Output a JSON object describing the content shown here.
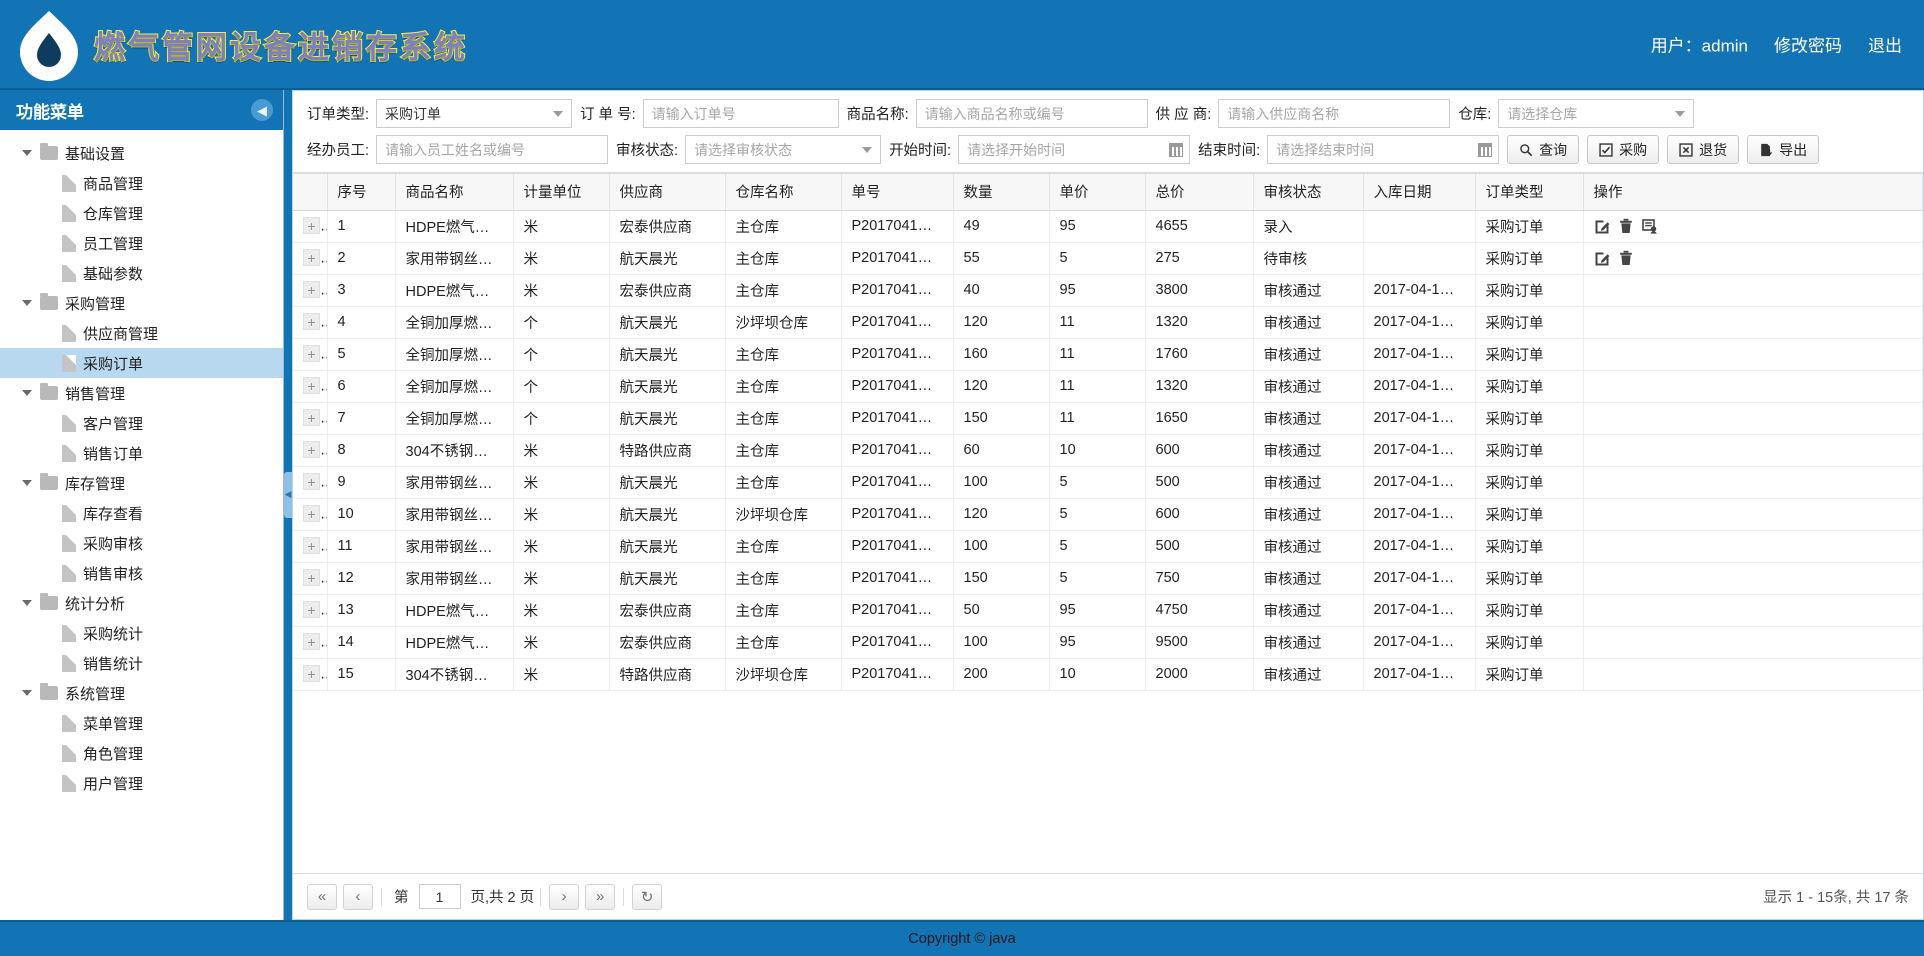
{
  "header": {
    "title": "燃气管网设备进销存系统",
    "logo_icon": "gas-drop-flame-logo",
    "user_label": "用户：admin",
    "change_password": "修改密码",
    "logout": "退出"
  },
  "sidebar": {
    "title": "功能菜单",
    "collapse_icon": "chevron-left-icon",
    "groups": [
      {
        "label": "基础设置",
        "children": [
          "商品管理",
          "仓库管理",
          "员工管理",
          "基础参数"
        ]
      },
      {
        "label": "采购管理",
        "children": [
          "供应商管理",
          "采购订单"
        ]
      },
      {
        "label": "销售管理",
        "children": [
          "客户管理",
          "销售订单"
        ]
      },
      {
        "label": "库存管理",
        "children": [
          "库存查看",
          "采购审核",
          "销售审核"
        ]
      },
      {
        "label": "统计分析",
        "children": [
          "采购统计",
          "销售统计"
        ]
      },
      {
        "label": "系统管理",
        "children": [
          "菜单管理",
          "角色管理",
          "用户管理"
        ]
      }
    ],
    "active_item": "采购订单"
  },
  "filters": {
    "order_type": {
      "label": "订单类型:",
      "value": "采购订单"
    },
    "order_no": {
      "label": "订 单 号:",
      "placeholder": "请输入订单号",
      "value": ""
    },
    "goods_name": {
      "label": "商品名称:",
      "placeholder": "请输入商品名称或编号",
      "value": ""
    },
    "supplier": {
      "label": "供 应 商:",
      "placeholder": "请输入供应商名称",
      "value": ""
    },
    "warehouse": {
      "label": "仓库:",
      "placeholder": "请选择仓库",
      "value": ""
    },
    "staff": {
      "label": "经办员工:",
      "placeholder": "请输入员工姓名或编号",
      "value": ""
    },
    "audit_status": {
      "label": "审核状态:",
      "placeholder": "请选择审核状态",
      "value": ""
    },
    "start_time": {
      "label": "开始时间:",
      "placeholder": "请选择开始时间",
      "value": ""
    },
    "end_time": {
      "label": "结束时间:",
      "placeholder": "请选择结束时间",
      "value": ""
    },
    "buttons": [
      {
        "label": "查询",
        "icon": "search-icon"
      },
      {
        "label": "采购",
        "icon": "checkbox-check-icon"
      },
      {
        "label": "退货",
        "icon": "box-x-icon"
      },
      {
        "label": "导出",
        "icon": "export-file-icon"
      }
    ]
  },
  "table": {
    "columns": [
      "序号",
      "商品名称",
      "计量单位",
      "供应商",
      "仓库名称",
      "单号",
      "数量",
      "单价",
      "总价",
      "审核状态",
      "入库日期",
      "订单类型",
      "操作"
    ],
    "expand_icon": "plus-expand-icon",
    "rows": [
      {
        "no": "1",
        "goods": "HDPE燃气…",
        "unit": "米",
        "supplier": "宏泰供应商",
        "warehouse": "主仓库",
        "order_no": "P2017041…",
        "qty": "49",
        "price": "95",
        "total": "4655",
        "status": "录入",
        "in_date": "",
        "type": "采购订单",
        "ops": [
          "edit-icon",
          "delete-icon",
          "submit-audit-icon"
        ]
      },
      {
        "no": "2",
        "goods": "家用带钢丝…",
        "unit": "米",
        "supplier": "航天晨光",
        "warehouse": "主仓库",
        "order_no": "P2017041…",
        "qty": "55",
        "price": "5",
        "total": "275",
        "status": "待审核",
        "in_date": "",
        "type": "采购订单",
        "ops": [
          "edit-icon",
          "delete-icon"
        ]
      },
      {
        "no": "3",
        "goods": "HDPE燃气…",
        "unit": "米",
        "supplier": "宏泰供应商",
        "warehouse": "主仓库",
        "order_no": "P2017041…",
        "qty": "40",
        "price": "95",
        "total": "3800",
        "status": "审核通过",
        "in_date": "2017-04-1…",
        "type": "采购订单",
        "ops": []
      },
      {
        "no": "4",
        "goods": "全铜加厚燃…",
        "unit": "个",
        "supplier": "航天晨光",
        "warehouse": "沙坪坝仓库",
        "order_no": "P2017041…",
        "qty": "120",
        "price": "11",
        "total": "1320",
        "status": "审核通过",
        "in_date": "2017-04-1…",
        "type": "采购订单",
        "ops": []
      },
      {
        "no": "5",
        "goods": "全铜加厚燃…",
        "unit": "个",
        "supplier": "航天晨光",
        "warehouse": "主仓库",
        "order_no": "P2017041…",
        "qty": "160",
        "price": "11",
        "total": "1760",
        "status": "审核通过",
        "in_date": "2017-04-1…",
        "type": "采购订单",
        "ops": []
      },
      {
        "no": "6",
        "goods": "全铜加厚燃…",
        "unit": "个",
        "supplier": "航天晨光",
        "warehouse": "主仓库",
        "order_no": "P2017041…",
        "qty": "120",
        "price": "11",
        "total": "1320",
        "status": "审核通过",
        "in_date": "2017-04-1…",
        "type": "采购订单",
        "ops": []
      },
      {
        "no": "7",
        "goods": "全铜加厚燃…",
        "unit": "个",
        "supplier": "航天晨光",
        "warehouse": "主仓库",
        "order_no": "P2017041…",
        "qty": "150",
        "price": "11",
        "total": "1650",
        "status": "审核通过",
        "in_date": "2017-04-1…",
        "type": "采购订单",
        "ops": []
      },
      {
        "no": "8",
        "goods": "304不锈钢…",
        "unit": "米",
        "supplier": "特路供应商",
        "warehouse": "主仓库",
        "order_no": "P2017041…",
        "qty": "60",
        "price": "10",
        "total": "600",
        "status": "审核通过",
        "in_date": "2017-04-1…",
        "type": "采购订单",
        "ops": []
      },
      {
        "no": "9",
        "goods": "家用带钢丝…",
        "unit": "米",
        "supplier": "航天晨光",
        "warehouse": "主仓库",
        "order_no": "P2017041…",
        "qty": "100",
        "price": "5",
        "total": "500",
        "status": "审核通过",
        "in_date": "2017-04-1…",
        "type": "采购订单",
        "ops": []
      },
      {
        "no": "10",
        "goods": "家用带钢丝…",
        "unit": "米",
        "supplier": "航天晨光",
        "warehouse": "沙坪坝仓库",
        "order_no": "P2017041…",
        "qty": "120",
        "price": "5",
        "total": "600",
        "status": "审核通过",
        "in_date": "2017-04-1…",
        "type": "采购订单",
        "ops": []
      },
      {
        "no": "11",
        "goods": "家用带钢丝…",
        "unit": "米",
        "supplier": "航天晨光",
        "warehouse": "主仓库",
        "order_no": "P2017041…",
        "qty": "100",
        "price": "5",
        "total": "500",
        "status": "审核通过",
        "in_date": "2017-04-1…",
        "type": "采购订单",
        "ops": []
      },
      {
        "no": "12",
        "goods": "家用带钢丝…",
        "unit": "米",
        "supplier": "航天晨光",
        "warehouse": "主仓库",
        "order_no": "P2017041…",
        "qty": "150",
        "price": "5",
        "total": "750",
        "status": "审核通过",
        "in_date": "2017-04-1…",
        "type": "采购订单",
        "ops": []
      },
      {
        "no": "13",
        "goods": "HDPE燃气…",
        "unit": "米",
        "supplier": "宏泰供应商",
        "warehouse": "主仓库",
        "order_no": "P2017041…",
        "qty": "50",
        "price": "95",
        "total": "4750",
        "status": "审核通过",
        "in_date": "2017-04-1…",
        "type": "采购订单",
        "ops": []
      },
      {
        "no": "14",
        "goods": "HDPE燃气…",
        "unit": "米",
        "supplier": "宏泰供应商",
        "warehouse": "主仓库",
        "order_no": "P2017041…",
        "qty": "100",
        "price": "95",
        "total": "9500",
        "status": "审核通过",
        "in_date": "2017-04-1…",
        "type": "采购订单",
        "ops": []
      },
      {
        "no": "15",
        "goods": "304不锈钢…",
        "unit": "米",
        "supplier": "特路供应商",
        "warehouse": "沙坪坝仓库",
        "order_no": "P2017041…",
        "qty": "200",
        "price": "10",
        "total": "2000",
        "status": "审核通过",
        "in_date": "2017-04-1…",
        "type": "采购订单",
        "ops": []
      }
    ]
  },
  "pager": {
    "first_icon": "double-chevron-left-icon",
    "prev_icon": "chevron-left-icon",
    "next_icon": "chevron-right-icon",
    "last_icon": "double-chevron-right-icon",
    "refresh_icon": "refresh-icon",
    "page_prefix": "第",
    "page_value": "1",
    "page_suffix": "页,共 2 页",
    "summary": "显示 1 - 15条,  共 17 条"
  },
  "footer": {
    "text": "Copyright © java"
  },
  "colors": {
    "brand_blue": "#1273b5",
    "header_title_fill": "#7d7fc0",
    "header_title_stroke": "#f2ee3a",
    "active_menu": "#b7d8ee",
    "grid_header": "#f7f7f7"
  }
}
